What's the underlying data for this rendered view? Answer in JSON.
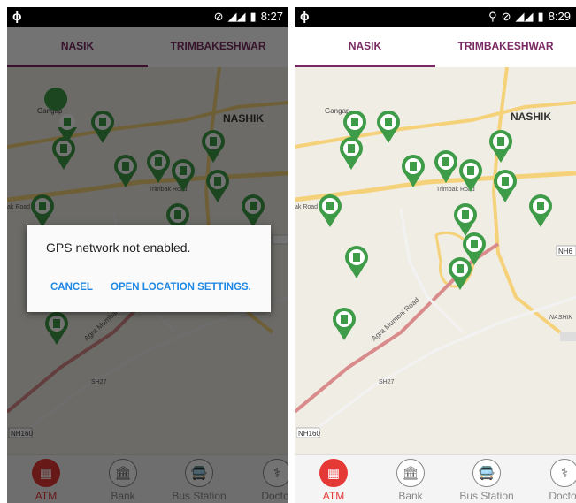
{
  "status_left": {
    "app_glyph": "ɸ",
    "time": "8:27"
  },
  "status_right": {
    "app_glyph": "ɸ",
    "time": "8:29"
  },
  "tabs": [
    "NASIK",
    "TRIMBAKESHWAR"
  ],
  "map_labels": {
    "city": "NASHIK",
    "gangapur": "Gangap",
    "trimbak_road": "Trimbak Road",
    "ak_road": "ak Road",
    "agra_road": "Agra Mumbai Road",
    "sh27": "SH27",
    "nh160": "NH160",
    "nh_right": "NH6",
    "nashik_right": "NASHIK"
  },
  "bottom_nav": [
    {
      "label": "ATM",
      "icon": "atm-icon",
      "glyph": "▦"
    },
    {
      "label": "Bank",
      "icon": "bank-icon",
      "glyph": "🏛"
    },
    {
      "label": "Bus Station",
      "icon": "bus-icon",
      "glyph": "🚍"
    },
    {
      "label": "Doctor",
      "icon": "doctor-icon",
      "glyph": "⚕"
    }
  ],
  "dialog": {
    "message": "GPS network not enabled.",
    "cancel": "CANCEL",
    "open_settings": "OPEN LOCATION SETTINGS."
  },
  "colors": {
    "accent": "#7a2a63",
    "pin": "#3e9c48",
    "active_nav": "#e53935",
    "dialog_button": "#1e88e5"
  }
}
